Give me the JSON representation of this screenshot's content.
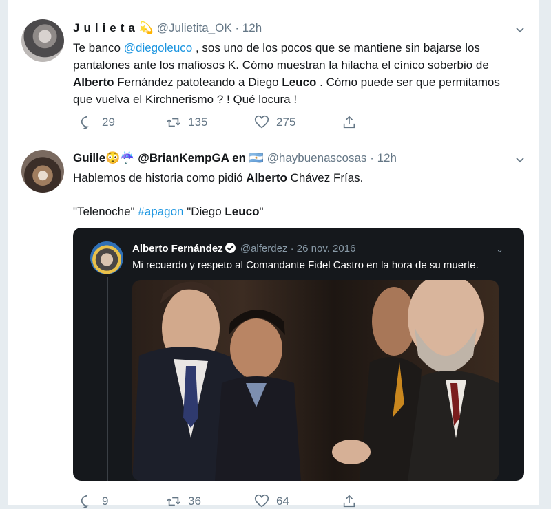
{
  "tweet1": {
    "name": "Julieta",
    "emoji": "💫",
    "handle": "@Julietita_OK",
    "time": "· 12h",
    "text": {
      "p1": "Te banco ",
      "mention": "@diegoleuco",
      "p2": " , sos uno de los pocos que se mantiene sin bajarse los pantalones ante los mafiosos K. Cómo muestran la hilacha el cínico soberbio de ",
      "b1": "Alberto",
      "p3": " Fernández patoteando a Diego ",
      "b2": "Leuco",
      "p4": " . Cómo puede ser que permitamos que vuelva el Kirchnerismo ? ! Qué locura !"
    },
    "replies": "29",
    "retweets": "135",
    "likes": "275"
  },
  "tweet2": {
    "name": "Guille😳☔ @BrianKempGA en 🇦🇷",
    "handle": "@haybuenascosas",
    "time": "· 12h",
    "line1_pre": "Hablemos de historia como pidió ",
    "line1_bold": "Alberto",
    "line1_post": " Chávez Frías.",
    "line2_a": "\"Telenoche\" ",
    "line2_hashtag": "#apagon",
    "line2_b": "  \"Diego ",
    "line2_bold": "Leuco",
    "line2_c": "\"",
    "quote": {
      "name": "Alberto Fernández",
      "handle": "@alferdez",
      "date": "· 26 nov. 2016",
      "text": "Mi recuerdo y respeto al Comandante Fidel Castro en la hora de su muerte."
    },
    "replies": "9",
    "retweets": "36",
    "likes": "64"
  },
  "colors": {
    "accent": "#1b95e0",
    "muted": "#657786",
    "dark_card": "#15181c"
  }
}
